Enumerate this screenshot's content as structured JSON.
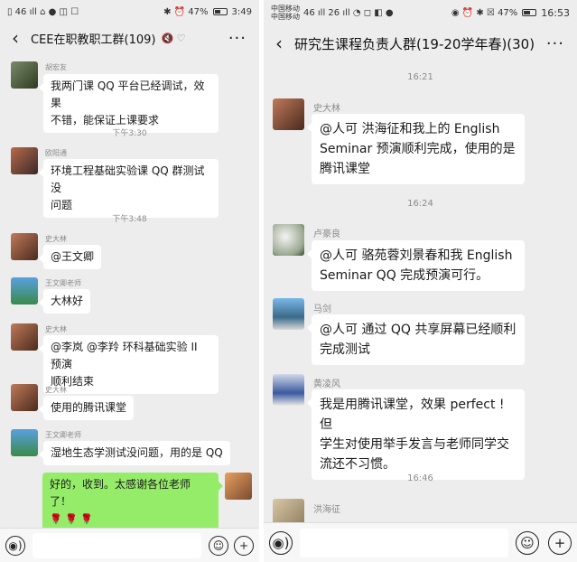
{
  "left": {
    "status": {
      "left_icons": "▯ 46 ıll ⌂ ● ◫ ☐",
      "right_text": "✱ ⏰ 47%",
      "time": "3:49"
    },
    "title": "CEE在职教职工群(109)",
    "title_icons": "🔇 ♡",
    "more": "···",
    "messages": [
      {
        "type": "text",
        "sender": "胡宏友",
        "lines": [
          "我两门课 QQ 平台已经调试，效果",
          "不错，能保证上课要求"
        ]
      },
      {
        "type": "time",
        "text": "下午3:30"
      },
      {
        "type": "text",
        "sender": "欧阳通",
        "lines": [
          "环境工程基础实验课 QQ 群测试没",
          "问题"
        ]
      },
      {
        "type": "time",
        "text": "下午3:48"
      },
      {
        "type": "text",
        "sender": "史大林",
        "lines": [
          "@王文卿"
        ]
      },
      {
        "type": "text",
        "sender": "王文卿老师",
        "lines": [
          "大林好"
        ]
      },
      {
        "type": "text",
        "sender": "史大林",
        "lines": [
          "@李岚 @李羚 环科基础实验 II 预演",
          "顺利结束"
        ]
      },
      {
        "type": "text",
        "sender": "史大林",
        "lines": [
          "使用的腾讯课堂"
        ]
      },
      {
        "type": "text",
        "sender": "王文卿老师",
        "lines": [
          "湿地生态学测试没问题，用的是 QQ"
        ]
      },
      {
        "type": "mine",
        "lines": [
          "好的，收到。太感谢各位老师了！",
          "🌹 🌹 🌹"
        ]
      }
    ]
  },
  "right": {
    "status": {
      "carrier1": "中国移动",
      "carrier2": "中国移动",
      "icons": "46 ıll 26 ıll ◔ ◻ ◧ ●",
      "right_text": "◉ ⏰ ✱ ☒ 47%",
      "time": "16:53"
    },
    "title": "研究生课程负责人群(19-20学年春)(30)",
    "more": "···",
    "messages": [
      {
        "type": "time",
        "text": "16:21"
      },
      {
        "type": "text",
        "sender": "史大林",
        "lines": [
          "@人可 洪海征和我上的 English",
          "Seminar 预演顺利完成，使用的是",
          "腾讯课堂"
        ]
      },
      {
        "type": "time",
        "text": "16:24"
      },
      {
        "type": "text",
        "sender": "卢豪良",
        "lines": [
          "@人可  骆苑蓉刘景春和我 English",
          "Seminar QQ 完成预演可行。"
        ]
      },
      {
        "type": "text",
        "sender": "马剑",
        "lines": [
          "@人可  通过 QQ 共享屏幕已经顺利",
          "完成测试"
        ]
      },
      {
        "type": "text",
        "sender": "黄凌风",
        "lines": [
          "我是用腾讯课堂，效果 perfect ! 但",
          "学生对使用举手发言与老师同学交",
          "流还不习惯。"
        ]
      },
      {
        "type": "time",
        "text": "16:46"
      },
      {
        "type": "text",
        "sender": "洪海征",
        "lines": []
      }
    ]
  },
  "input": {
    "voice_icon": "◉)",
    "emoji_icon": "☺",
    "plus_icon": "+"
  }
}
